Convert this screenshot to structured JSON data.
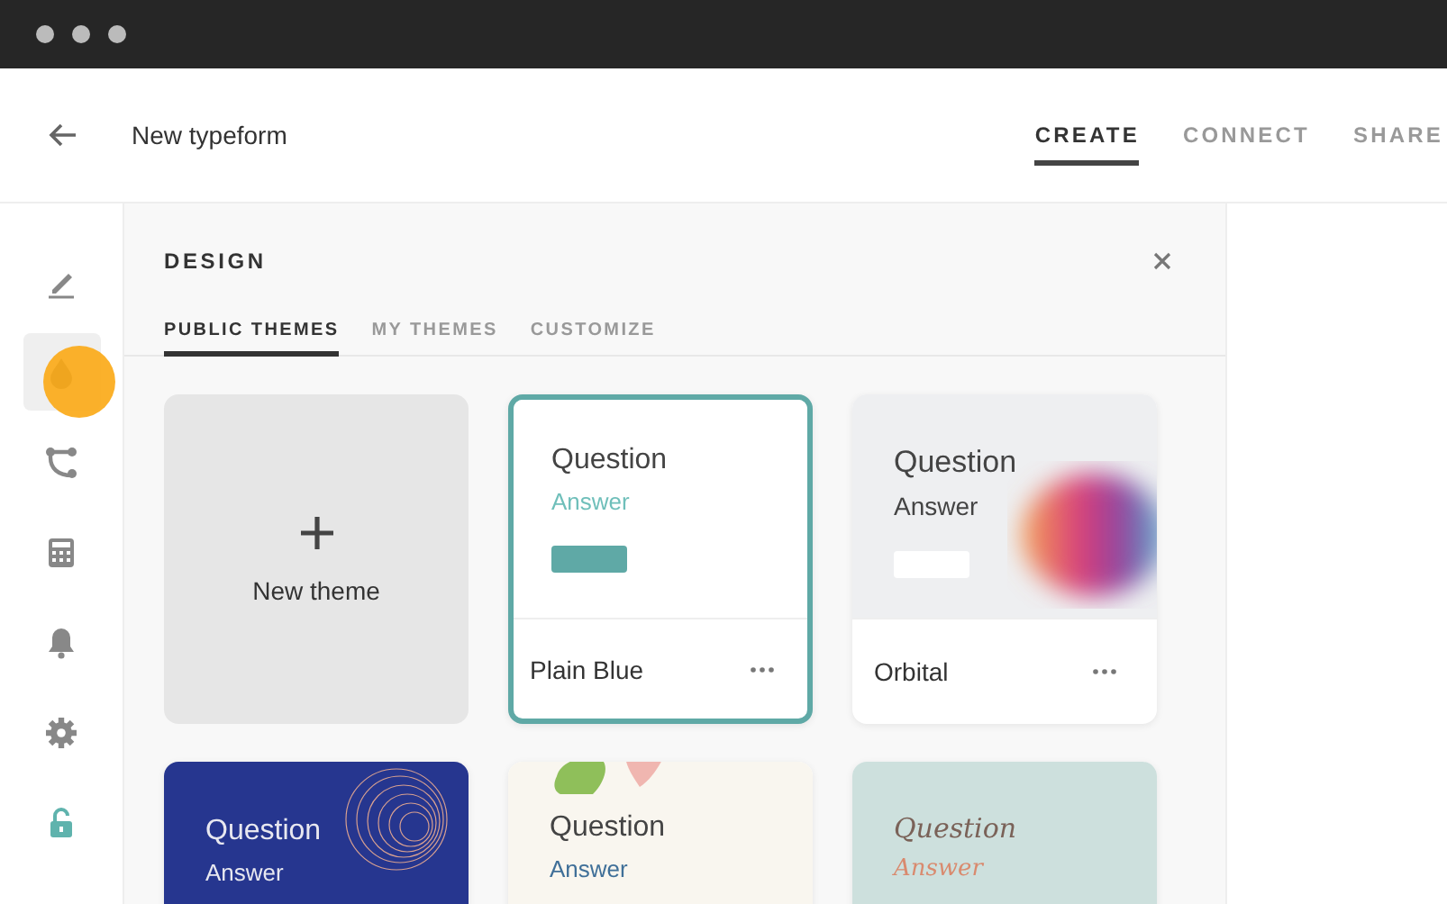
{
  "header": {
    "title": "New typeform",
    "tabs": [
      {
        "label": "CREATE",
        "selected": true
      },
      {
        "label": "CONNECT",
        "selected": false
      },
      {
        "label": "SHARE",
        "selected": false
      }
    ]
  },
  "sidebar": {
    "items": [
      {
        "kind": "pen",
        "selected": false
      },
      {
        "kind": "drop",
        "selected": true
      },
      {
        "kind": "branch",
        "selected": false
      },
      {
        "kind": "calculator",
        "selected": false
      },
      {
        "kind": "bell",
        "selected": false
      },
      {
        "kind": "gear",
        "selected": false
      },
      {
        "kind": "lock",
        "selected": false
      }
    ]
  },
  "design": {
    "title": "DESIGN",
    "tabs": [
      {
        "label": "PUBLIC THEMES",
        "selected": true
      },
      {
        "label": "MY THEMES",
        "selected": false
      },
      {
        "label": "CUSTOMIZE",
        "selected": false
      }
    ],
    "new_theme": {
      "label": "New theme"
    },
    "themes": [
      {
        "kind": "plain",
        "question": "Question",
        "answer": "Answer",
        "name": "Plain Blue",
        "selected": true
      },
      {
        "kind": "orbital",
        "question": "Question",
        "answer": "Answer",
        "name": "Orbital",
        "selected": false
      },
      {
        "kind": "navy",
        "question": "Question",
        "answer": "Answer",
        "selected": false
      },
      {
        "kind": "cream",
        "question": "Question",
        "answer": "Answer",
        "selected": false
      },
      {
        "kind": "sage",
        "question": "Question",
        "answer": "Answer",
        "selected": false
      }
    ]
  }
}
